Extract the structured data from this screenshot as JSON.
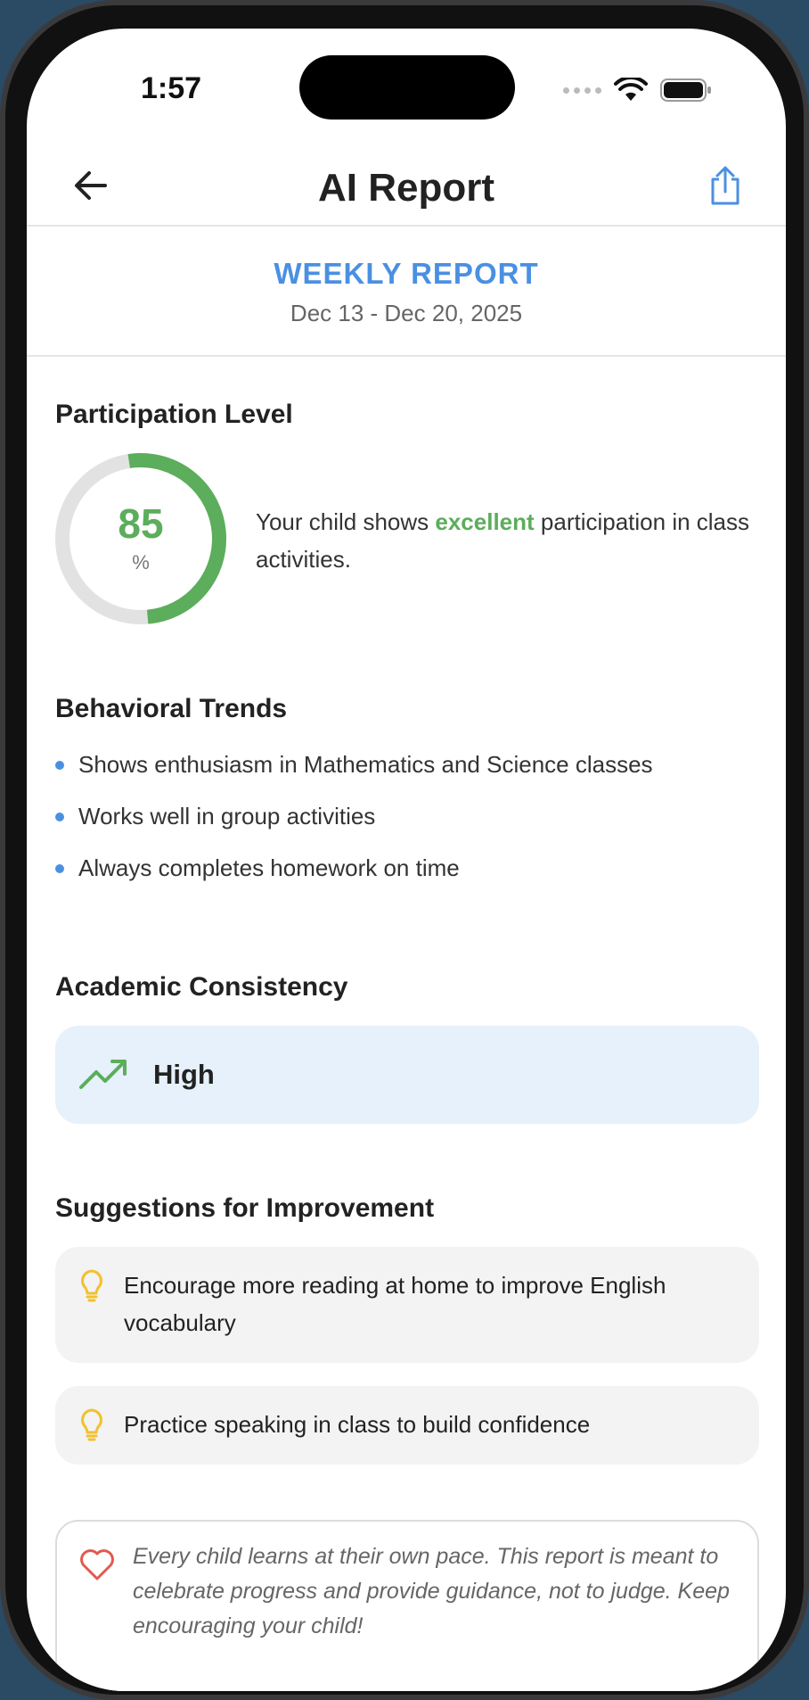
{
  "status_bar": {
    "time": "1:57"
  },
  "nav": {
    "title": "AI Report",
    "back_icon": "arrow-left-icon",
    "share_icon": "share-icon"
  },
  "report": {
    "type": "WEEKLY REPORT",
    "date_range": "Dec 13 - Dec 20, 2025"
  },
  "participation": {
    "title": "Participation Level",
    "value": "85",
    "unit": "%",
    "percent": 85,
    "text_before": "Your child shows ",
    "highlight": "excellent",
    "text_after": " participation in class activities.",
    "colors": {
      "accent": "#5cad5c",
      "track": "#e2e2e2"
    }
  },
  "trends": {
    "title": "Behavioral Trends",
    "items": [
      "Shows enthusiasm in Mathematics and Science classes",
      "Works well in group activities",
      "Always completes homework on time"
    ]
  },
  "consistency": {
    "title": "Academic Consistency",
    "level": "High",
    "icon": "trending-up-icon"
  },
  "suggestions": {
    "title": "Suggestions for Improvement",
    "items": [
      "Encourage more reading at home to improve English vocabulary",
      "Practice speaking in class to build confidence"
    ],
    "icon": "lightbulb-icon"
  },
  "note": {
    "text": "Every child learns at their own pace. This report is meant to celebrate progress and provide guidance, not to judge. Keep encouraging your child!",
    "icon": "heart-icon"
  },
  "colors": {
    "accent_blue": "#4a90e2",
    "accent_green": "#5cad5c",
    "bulb_yellow": "#f2c12e",
    "heart_red": "#e05a4f"
  }
}
